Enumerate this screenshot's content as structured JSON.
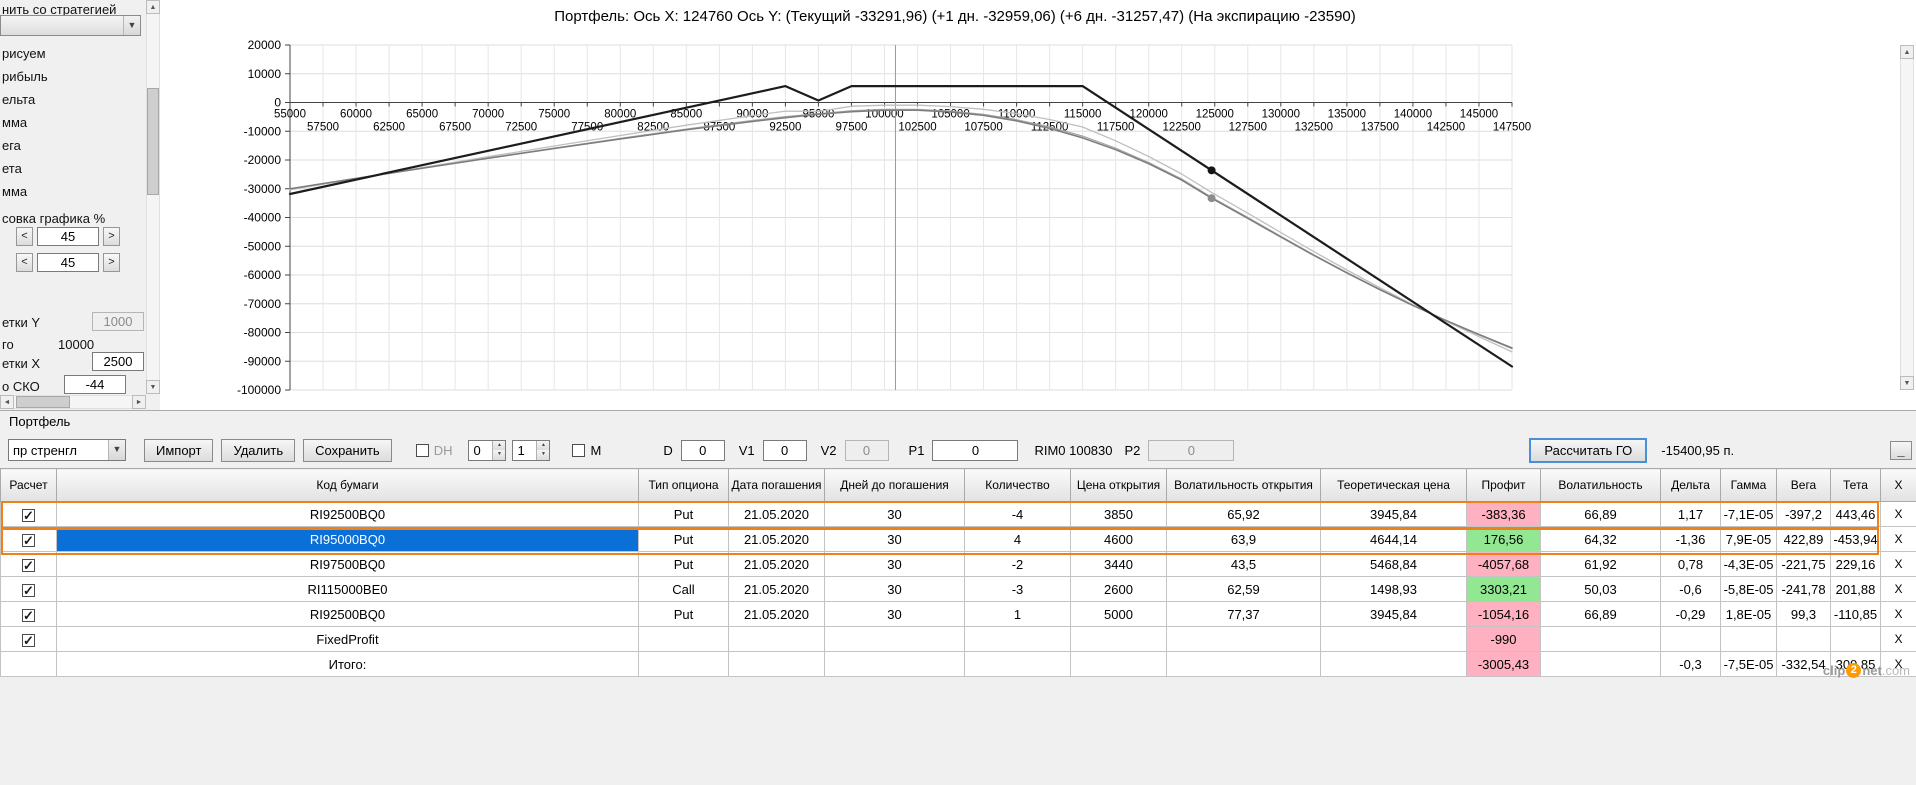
{
  "sidebar": {
    "strategy_caption": "нить со стратегией",
    "strategy_value": "",
    "draw_items": [
      "рисуем",
      "рибыль",
      "ельта",
      "мма",
      "ега",
      "ета",
      "мма"
    ],
    "scale_caption": "совка графика %",
    "spin_left": "<",
    "spin_right": ">",
    "scale_x_value": "45",
    "scale_y_value": "45",
    "grid_y_label": "етки Y",
    "grid_y_value": "1000",
    "total_label": "го",
    "total_value": "10000",
    "grid_x_label": "етки X",
    "grid_x_value": "2500",
    "sko_label": "о СКО",
    "sko_value": "-44"
  },
  "chart_data": {
    "type": "line",
    "title": "Портфель: Ось X: 124760 Ось Y:  (Текущий -33291,96)  (+1 дн. -32959,06)  (+6 дн. -31257,47)  (На экспирацию -23590)",
    "x_domain": [
      55000,
      147500
    ],
    "y_domain": [
      -100000,
      20000
    ],
    "x_tick_step": 2500,
    "y_tick_step": 10000,
    "grid": true,
    "vline_x": 100830,
    "series": [
      {
        "name": "plus6d",
        "color": "#bfbfbf",
        "width": 1.3,
        "points": [
          [
            55000,
            -30380
          ],
          [
            60000,
            -26486
          ],
          [
            65000,
            -22671
          ],
          [
            70000,
            -18856
          ],
          [
            75000,
            -15120
          ],
          [
            80000,
            -11463
          ],
          [
            85000,
            -7885
          ],
          [
            90000,
            -4544
          ],
          [
            92500,
            -2992
          ],
          [
            95000,
            -3094
          ],
          [
            97500,
            -1333
          ],
          [
            100000,
            -938
          ],
          [
            102500,
            -938
          ],
          [
            105000,
            -1412
          ],
          [
            107500,
            -2360
          ],
          [
            110000,
            -3861
          ],
          [
            112500,
            -5915
          ],
          [
            115000,
            -8522
          ],
          [
            117500,
            -13336
          ],
          [
            120000,
            -18782
          ],
          [
            122500,
            -24860
          ],
          [
            124760,
            -31255
          ],
          [
            127500,
            -38517
          ],
          [
            130000,
            -45227
          ],
          [
            132500,
            -51858
          ],
          [
            135000,
            -58252
          ],
          [
            137500,
            -64409
          ],
          [
            140000,
            -70329
          ],
          [
            142500,
            -76012
          ],
          [
            145000,
            -81458
          ],
          [
            147500,
            -86746
          ]
        ]
      },
      {
        "name": "plus1d",
        "color": "#a6a6a6",
        "width": 1.3,
        "points": [
          [
            55000,
            -30062
          ],
          [
            60000,
            -26414
          ],
          [
            65000,
            -22863
          ],
          [
            70000,
            -19312
          ],
          [
            75000,
            -15858
          ],
          [
            80000,
            -12500
          ],
          [
            85000,
            -9239
          ],
          [
            90000,
            -6267
          ],
          [
            92500,
            -4926
          ],
          [
            95000,
            -3937
          ],
          [
            97500,
            -2898
          ],
          [
            100000,
            -2415
          ],
          [
            102500,
            -2415
          ],
          [
            105000,
            -2994
          ],
          [
            107500,
            -4154
          ],
          [
            110000,
            -5989
          ],
          [
            112500,
            -8501
          ],
          [
            115000,
            -11688
          ],
          [
            117500,
            -15904
          ],
          [
            120000,
            -20892
          ],
          [
            122500,
            -26654
          ],
          [
            124760,
            -32962
          ],
          [
            127500,
            -40011
          ],
          [
            130000,
            -46545
          ],
          [
            132500,
            -52983
          ],
          [
            135000,
            -59130
          ],
          [
            137500,
            -64988
          ],
          [
            140000,
            -70556
          ],
          [
            142500,
            -75834
          ],
          [
            145000,
            -80823
          ],
          [
            147500,
            -85618
          ]
        ]
      },
      {
        "name": "current",
        "color": "#7d7d7d",
        "width": 1.5,
        "points": [
          [
            55000,
            -30000
          ],
          [
            60000,
            -26400
          ],
          [
            65000,
            -22900
          ],
          [
            70000,
            -19400
          ],
          [
            75000,
            -16000
          ],
          [
            80000,
            -12700
          ],
          [
            85000,
            -9500
          ],
          [
            90000,
            -6600
          ],
          [
            92500,
            -5300
          ],
          [
            95000,
            -4100
          ],
          [
            97500,
            -3200
          ],
          [
            100000,
            -2700
          ],
          [
            102500,
            -2700
          ],
          [
            105000,
            -3300
          ],
          [
            107500,
            -4500
          ],
          [
            110000,
            -6400
          ],
          [
            112500,
            -9000
          ],
          [
            115000,
            -12300
          ],
          [
            117500,
            -16400
          ],
          [
            120000,
            -21300
          ],
          [
            122500,
            -27000
          ],
          [
            124760,
            -33292
          ],
          [
            127500,
            -40300
          ],
          [
            130000,
            -46800
          ],
          [
            132500,
            -53200
          ],
          [
            135000,
            -59300
          ],
          [
            137500,
            -65100
          ],
          [
            140000,
            -70600
          ],
          [
            142500,
            -75800
          ],
          [
            145000,
            -80700
          ],
          [
            147500,
            -85400
          ]
        ]
      },
      {
        "name": "expiration",
        "color": "#1c1c1c",
        "width": 2.2,
        "points": [
          [
            55000,
            -31810
          ],
          [
            92500,
            5690
          ],
          [
            95000,
            690
          ],
          [
            97500,
            5690
          ],
          [
            115000,
            5690
          ],
          [
            147500,
            -91810
          ]
        ]
      }
    ],
    "markers": [
      {
        "x": 124760,
        "y": -23590,
        "color": "#151515"
      },
      {
        "x": 124760,
        "y": -33292,
        "color": "#8c8c8c"
      }
    ]
  },
  "portfolio": {
    "panel_title": "Портфель",
    "toolbar": {
      "strategy_value": "пр стренгл",
      "import": "Импорт",
      "delete": "Удалить",
      "save": "Сохранить",
      "dh": "DH",
      "spin1": "0",
      "spin2": "1",
      "m": "M",
      "d": "D",
      "d_val": "0",
      "v1": "V1",
      "v1_val": "0",
      "v2": "V2",
      "v2_val": "0",
      "p1": "P1",
      "p1_val": "0",
      "instrument": "RIM0 100830",
      "p2": "P2",
      "p2_val": "0",
      "calc_go": "Рассчитать ГО",
      "go_result": "-15400,95 п.",
      "minimize": "_"
    },
    "table": {
      "headers": [
        "Расчет",
        "Код бумаги",
        "Тип опциона",
        "Дата погашения",
        "Дней до погашения",
        "Количество",
        "Цена открытия",
        "Волатильность открытия",
        "Теоретическая цена",
        "Профит",
        "Волатильность",
        "Дельта",
        "Гамма",
        "Вега",
        "Тета",
        "X"
      ],
      "rows": [
        {
          "checked": true,
          "selected": false,
          "highlight": true,
          "code": "RI92500BQ0",
          "type": "Put",
          "date": "21.05.2020",
          "days": "30",
          "qty": "-4",
          "open_price": "3850",
          "open_vol": "65,92",
          "theor": "3945,84",
          "profit": "-383,36",
          "profit_state": "neg",
          "vol": "66,89",
          "delta": "1,17",
          "gamma": "-7,1E-05",
          "vega": "-397,2",
          "theta": "443,46",
          "x": "X"
        },
        {
          "checked": true,
          "selected": true,
          "highlight": true,
          "code": "RI95000BQ0",
          "type": "Put",
          "date": "21.05.2020",
          "days": "30",
          "qty": "4",
          "open_price": "4600",
          "open_vol": "63,9",
          "theor": "4644,14",
          "profit": "176,56",
          "profit_state": "pos",
          "vol": "64,32",
          "delta": "-1,36",
          "gamma": "7,9E-05",
          "vega": "422,89",
          "theta": "-453,94",
          "x": "X"
        },
        {
          "checked": true,
          "code": "RI97500BQ0",
          "type": "Put",
          "date": "21.05.2020",
          "days": "30",
          "qty": "-2",
          "open_price": "3440",
          "open_vol": "43,5",
          "theor": "5468,84",
          "profit": "-4057,68",
          "profit_state": "neg",
          "vol": "61,92",
          "delta": "0,78",
          "gamma": "-4,3E-05",
          "vega": "-221,75",
          "theta": "229,16",
          "x": "X"
        },
        {
          "checked": true,
          "code": "RI115000BE0",
          "type": "Call",
          "date": "21.05.2020",
          "days": "30",
          "qty": "-3",
          "open_price": "2600",
          "open_vol": "62,59",
          "theor": "1498,93",
          "profit": "3303,21",
          "profit_state": "pos",
          "vol": "50,03",
          "delta": "-0,6",
          "gamma": "-5,8E-05",
          "vega": "-241,78",
          "theta": "201,88",
          "x": "X"
        },
        {
          "checked": true,
          "code": "RI92500BQ0",
          "type": "Put",
          "date": "21.05.2020",
          "days": "30",
          "qty": "1",
          "open_price": "5000",
          "open_vol": "77,37",
          "theor": "3945,84",
          "profit": "-1054,16",
          "profit_state": "neg",
          "vol": "66,89",
          "delta": "-0,29",
          "gamma": "1,8E-05",
          "vega": "99,3",
          "theta": "-110,85",
          "x": "X"
        },
        {
          "checked": true,
          "code": "FixedProfit",
          "type": "",
          "date": "",
          "days": "",
          "qty": "",
          "open_price": "",
          "open_vol": "",
          "theor": "",
          "profit": "-990",
          "profit_state": "neg",
          "vol": "",
          "delta": "",
          "gamma": "",
          "vega": "",
          "theta": "",
          "x": "X"
        },
        {
          "total": true,
          "code": "Итого:",
          "type": "",
          "date": "",
          "days": "",
          "qty": "",
          "open_price": "",
          "open_vol": "",
          "theor": "",
          "profit": "-3005,43",
          "profit_state": "neg",
          "vol": "",
          "delta": "-0,3",
          "gamma": "-7,5E-05",
          "vega": "-332,54",
          "theta": "309,85",
          "x": "X"
        }
      ]
    }
  },
  "watermark": {
    "clip": "clip",
    "two": "2",
    "net": "net",
    "com": ".com"
  }
}
